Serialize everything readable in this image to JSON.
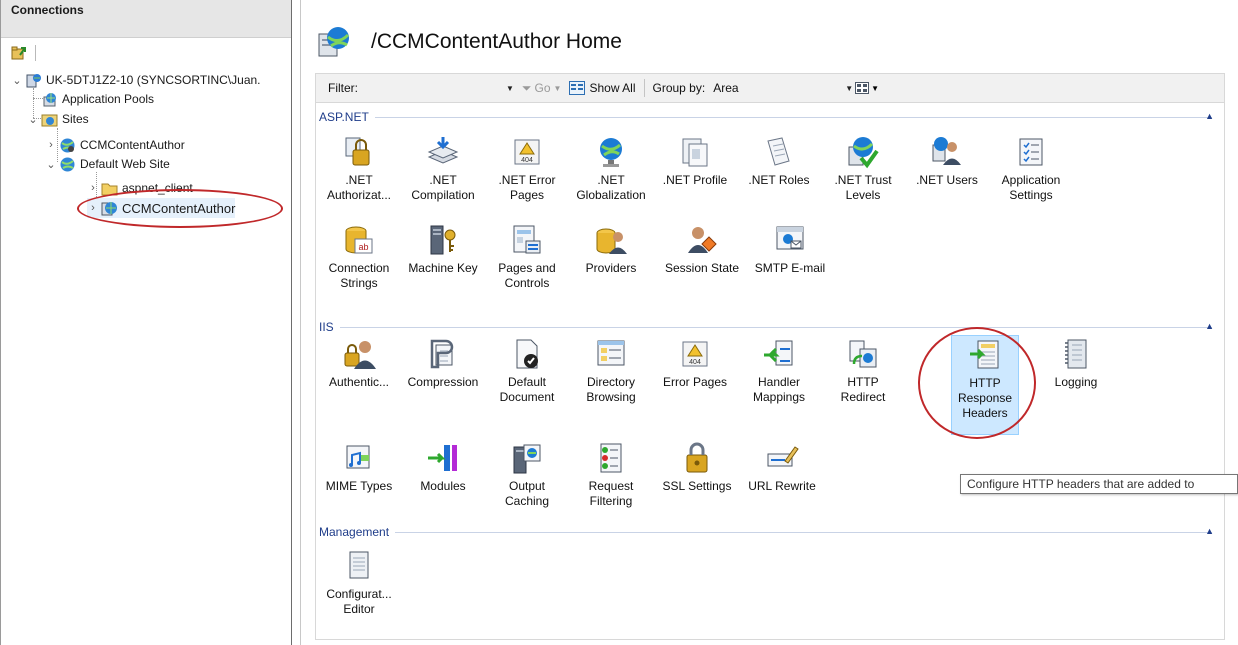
{
  "connections": {
    "header": "Connections",
    "tree": {
      "server": "UK-5DTJ1Z2-10 (SYNCSORTINC\\Juan.",
      "app_pools": "Application Pools",
      "sites": "Sites",
      "site1": "CCMContentAuthor",
      "default_site": "Default Web Site",
      "aspnet_client": "aspnet_client",
      "selected_app": "CCMContentAuthor"
    }
  },
  "page": {
    "title": "/CCMContentAuthor Home"
  },
  "filterbar": {
    "filter_label": "Filter:",
    "go_label": "Go",
    "show_all_label": "Show All",
    "group_by_label": "Group by:",
    "group_by_value": "Area"
  },
  "sections": {
    "aspnet": {
      "title": "ASP.NET",
      "items": [
        {
          "line1": ".NET",
          "line2": "Authorizat...",
          "icon": "net-authorization-icon"
        },
        {
          "line1": ".NET",
          "line2": "Compilation",
          "icon": "net-compilation-icon"
        },
        {
          "line1": ".NET Error",
          "line2": "Pages",
          "icon": "error-pages-icon"
        },
        {
          "line1": ".NET",
          "line2": "Globalization",
          "icon": "globe-icon"
        },
        {
          "line1": ".NET Profile",
          "line2": "",
          "icon": "profile-icon"
        },
        {
          "line1": ".NET Roles",
          "line2": "",
          "icon": "roles-icon"
        },
        {
          "line1": ".NET Trust",
          "line2": "Levels",
          "icon": "trust-levels-icon"
        },
        {
          "line1": ".NET Users",
          "line2": "",
          "icon": "users-icon"
        },
        {
          "line1": "Application",
          "line2": "Settings",
          "icon": "app-settings-icon"
        },
        {
          "line1": "Connection",
          "line2": "Strings",
          "icon": "connection-strings-icon"
        },
        {
          "line1": "Machine Key",
          "line2": "",
          "icon": "machine-key-icon"
        },
        {
          "line1": "Pages and",
          "line2": "Controls",
          "icon": "pages-controls-icon"
        },
        {
          "line1": "Providers",
          "line2": "",
          "icon": "providers-icon"
        },
        {
          "line1": "Session State",
          "line2": "",
          "icon": "session-state-icon"
        },
        {
          "line1": "SMTP E-mail",
          "line2": "",
          "icon": "smtp-email-icon"
        }
      ]
    },
    "iis": {
      "title": "IIS",
      "items": [
        {
          "line1": "Authentic...",
          "line2": "",
          "line3": "",
          "icon": "authentication-icon"
        },
        {
          "line1": "Compression",
          "line2": "",
          "line3": "",
          "icon": "compression-icon"
        },
        {
          "line1": "Default",
          "line2": "Document",
          "line3": "",
          "icon": "default-document-icon"
        },
        {
          "line1": "Directory",
          "line2": "Browsing",
          "line3": "",
          "icon": "directory-browsing-icon"
        },
        {
          "line1": "Error Pages",
          "line2": "",
          "line3": "",
          "icon": "error-pages-icon"
        },
        {
          "line1": "Handler",
          "line2": "Mappings",
          "line3": "",
          "icon": "handler-mappings-icon"
        },
        {
          "line1": "HTTP",
          "line2": "Redirect",
          "line3": "",
          "icon": "http-redirect-icon"
        },
        {
          "line1": "HTTP",
          "line2": "Response",
          "line3": "Headers",
          "icon": "http-response-headers-icon"
        },
        {
          "line1": "Logging",
          "line2": "",
          "line3": "",
          "icon": "logging-icon"
        },
        {
          "line1": "MIME Types",
          "line2": "",
          "line3": "",
          "icon": "mime-types-icon"
        },
        {
          "line1": "Modules",
          "line2": "",
          "line3": "",
          "icon": "modules-icon"
        },
        {
          "line1": "Output",
          "line2": "Caching",
          "line3": "",
          "icon": "output-caching-icon"
        },
        {
          "line1": "Request",
          "line2": "Filtering",
          "line3": "",
          "icon": "request-filtering-icon"
        },
        {
          "line1": "SSL Settings",
          "line2": "",
          "line3": "",
          "icon": "ssl-settings-icon"
        },
        {
          "line1": "URL Rewrite",
          "line2": "",
          "line3": "",
          "icon": "url-rewrite-icon"
        }
      ]
    },
    "management": {
      "title": "Management",
      "items": [
        {
          "line1": "Configurat...",
          "line2": "Editor",
          "icon": "configuration-editor-icon"
        }
      ]
    }
  },
  "tooltip": "Configure HTTP headers that are added to",
  "colors": {
    "accent": "#1f3d8a",
    "annotation": "#c0282a",
    "selection": "#cde8ff"
  }
}
